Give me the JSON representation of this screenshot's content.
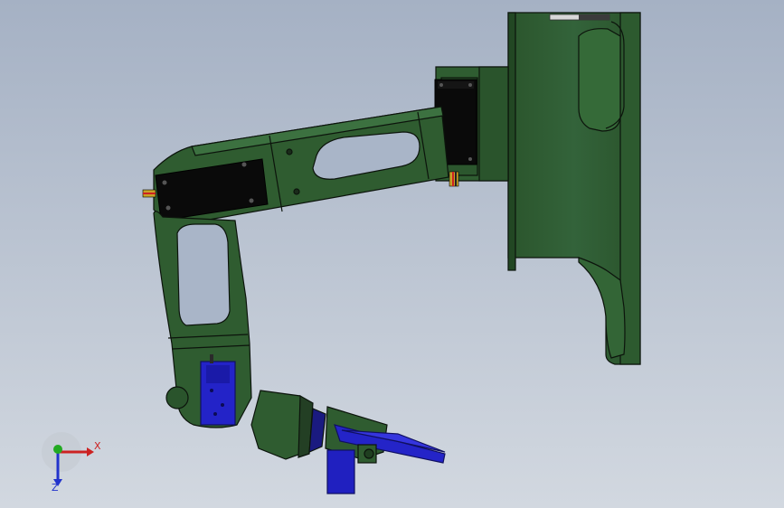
{
  "colors": {
    "background_top": "#a7b3c6",
    "background_bottom": "#d0d6df",
    "body_green": "#2f5a30",
    "body_green_light": "#3f7540",
    "edge": "#101810",
    "servo_black": "#0a0a0a",
    "blue_part": "#2222cc",
    "blue_dark": "#12128a",
    "axis_x": "#cc2222",
    "axis_y": "#22aa22",
    "axis_z": "#2233cc"
  },
  "triad": {
    "x_label": "X",
    "z_label": "Z"
  },
  "icons": [
    "coordinate-triad-icon"
  ]
}
